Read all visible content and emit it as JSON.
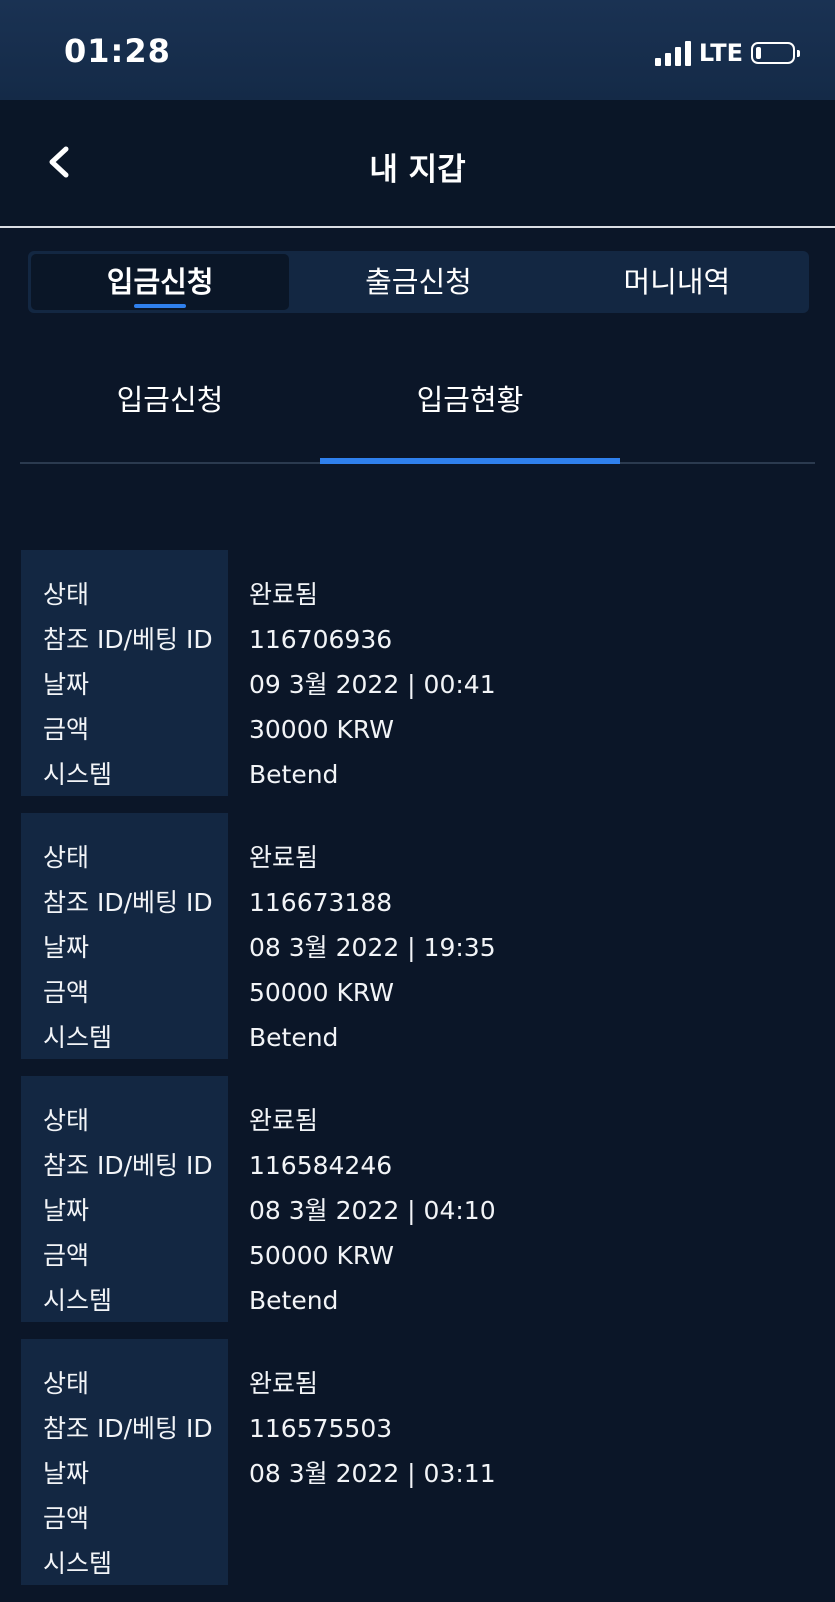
{
  "status_bar": {
    "time": "01:28",
    "network": "LTE",
    "battery_level": 0.15
  },
  "header": {
    "title": "내 지갑",
    "back_icon": "chevron-left-icon"
  },
  "main_tabs": [
    {
      "label": "입금신청",
      "active": true
    },
    {
      "label": "출금신청",
      "active": false
    },
    {
      "label": "머니내역",
      "active": false
    }
  ],
  "sub_tabs": [
    {
      "label": "입금신청",
      "active": false
    },
    {
      "label": "입금현황",
      "active": true
    }
  ],
  "field_labels": {
    "status": "상태",
    "ref_id": "참조 ID/베팅 ID",
    "date": "날짜",
    "amount": "금액",
    "system": "시스템"
  },
  "records": [
    {
      "status": "완료됨",
      "ref_id": "116706936",
      "date": "09 3월 2022 | 00:41",
      "amount": "30000 KRW",
      "system": "Betend"
    },
    {
      "status": "완료됨",
      "ref_id": "116673188",
      "date": "08 3월 2022 | 19:35",
      "amount": "50000 KRW",
      "system": "Betend"
    },
    {
      "status": "완료됨",
      "ref_id": "116584246",
      "date": "08 3월 2022 | 04:10",
      "amount": "50000 KRW",
      "system": "Betend"
    },
    {
      "status": "완료됨",
      "ref_id": "116575503",
      "date": "08 3월 2022 | 03:11",
      "amount": "",
      "system": ""
    }
  ],
  "colors": {
    "background": "#0b1628",
    "panel": "#132742",
    "accent": "#2f80ed",
    "status_bar": "#1a3253"
  }
}
